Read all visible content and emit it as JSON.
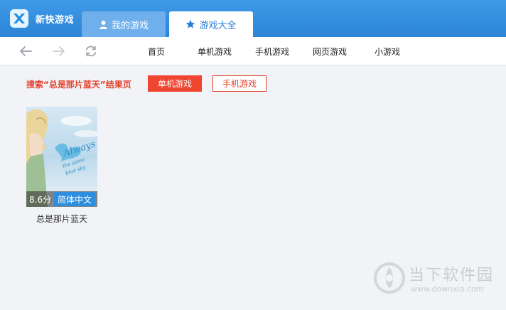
{
  "app": {
    "title": "新快游戏"
  },
  "tabs": [
    {
      "label": "我的游戏",
      "icon": "user-icon",
      "active": false
    },
    {
      "label": "游戏大全",
      "icon": "star-icon",
      "active": true
    }
  ],
  "nav": {
    "back_icon": "back-arrow-icon",
    "forward_icon": "forward-arrow-icon",
    "refresh_icon": "refresh-icon",
    "links": [
      "首页",
      "单机游戏",
      "手机游戏",
      "网页游戏",
      "小游戏"
    ]
  },
  "search": {
    "result_label": "搜索“总是那片蓝天”结果页",
    "filters": [
      {
        "label": "单机游戏",
        "active": true
      },
      {
        "label": "手机游戏",
        "active": false
      }
    ]
  },
  "results": [
    {
      "name": "总是那片蓝天",
      "rating": "8.6分",
      "badge": "简体中文",
      "cover_art_text": "Always the same blue sky"
    }
  ],
  "watermark": {
    "name": "当下软件园",
    "url": "www.downxia.com"
  },
  "colors": {
    "titlebar": "#2b84d6",
    "accent_red": "#f04530",
    "badge_blue": "#2d8ee0",
    "background": "#f1f3f6"
  }
}
